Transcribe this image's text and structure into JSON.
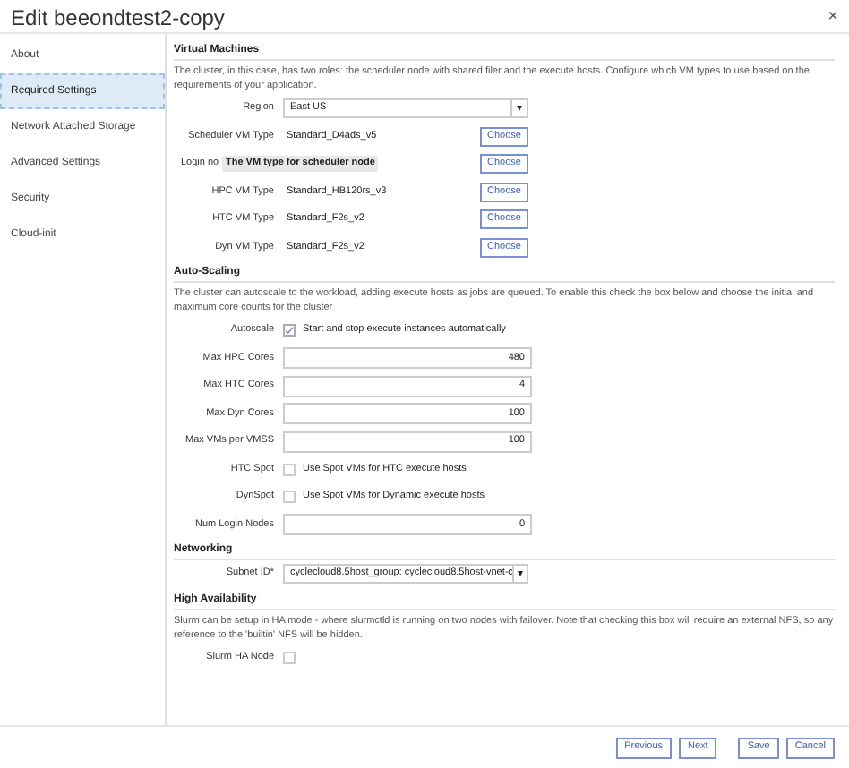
{
  "window": {
    "title": "Edit beeondtest2-copy",
    "close": "×"
  },
  "sidebar": {
    "items": [
      {
        "label": "About",
        "selected": false
      },
      {
        "label": "Required Settings",
        "selected": true
      },
      {
        "label": "Network Attached Storage",
        "selected": false
      },
      {
        "label": "Advanced Settings",
        "selected": false
      },
      {
        "label": "Security",
        "selected": false
      },
      {
        "label": "Cloud-init",
        "selected": false
      }
    ]
  },
  "sections": [
    {
      "title": "Virtual Machines",
      "description": "The cluster, in this case, has two roles: the scheduler node with shared filer and the execute hosts. Configure which VM types to use based on the requirements of your application.",
      "fields": [
        {
          "kind": "select",
          "label": "Region",
          "value": "East US",
          "caret": "▾"
        },
        {
          "kind": "vm",
          "label": "Scheduler VM Type",
          "value": "Standard_D4ads_v5",
          "button": "Choose"
        },
        {
          "kind": "vm",
          "label": "Login no",
          "tooltip": "The VM type for scheduler node",
          "button": "Choose"
        },
        {
          "kind": "vm",
          "label": "HPC VM Type",
          "value": "Standard_HB120rs_v3",
          "button": "Choose"
        },
        {
          "kind": "vm",
          "label": "HTC VM Type",
          "value": "Standard_F2s_v2",
          "button": "Choose"
        },
        {
          "kind": "vm",
          "label": "Dyn VM Type",
          "value": "Standard_F2s_v2",
          "button": "Choose"
        }
      ]
    },
    {
      "title": "Auto-Scaling",
      "description": "The cluster can autoscale to the workload, adding execute hosts as jobs are queued. To enable this check the box below and choose the initial and maximum core counts for the cluster",
      "fields": [
        {
          "kind": "checkbox",
          "label": "Autoscale",
          "text": "Start and stop execute instances automatically",
          "checked": true
        },
        {
          "kind": "number",
          "label": "Max HPC Cores",
          "value": "480"
        },
        {
          "kind": "number",
          "label": "Max HTC Cores",
          "value": "4"
        },
        {
          "kind": "number",
          "label": "Max Dyn Cores",
          "value": "100"
        },
        {
          "kind": "number",
          "label": "Max VMs per VMSS",
          "value": "100"
        },
        {
          "kind": "checkbox",
          "label": "HTC Spot",
          "text": "Use Spot VMs for HTC execute hosts",
          "checked": false
        },
        {
          "kind": "checkbox",
          "label": "DynSpot",
          "text": "Use Spot VMs for Dynamic execute hosts",
          "checked": false
        },
        {
          "kind": "number",
          "label": "Num Login Nodes",
          "value": "0"
        }
      ]
    },
    {
      "title": "Networking",
      "fields": [
        {
          "kind": "select",
          "label": "Subnet ID*",
          "value": "cyclecloud8.5host_group: cyclecloud8.5host-vnet-c",
          "caret": "▾"
        }
      ]
    },
    {
      "title": "High Availability",
      "description": "Slurm can be setup in HA mode - where slurmctld is running on two nodes with failover. Note that checking this box will require an external NFS, so any reference to the 'builtin' NFS will be hidden.",
      "fields": [
        {
          "kind": "checkbox",
          "label": "Slurm HA Node",
          "checked": false
        }
      ]
    }
  ],
  "footer": {
    "buttons": [
      "Previous",
      "Next",
      "Save",
      "Cancel"
    ]
  }
}
